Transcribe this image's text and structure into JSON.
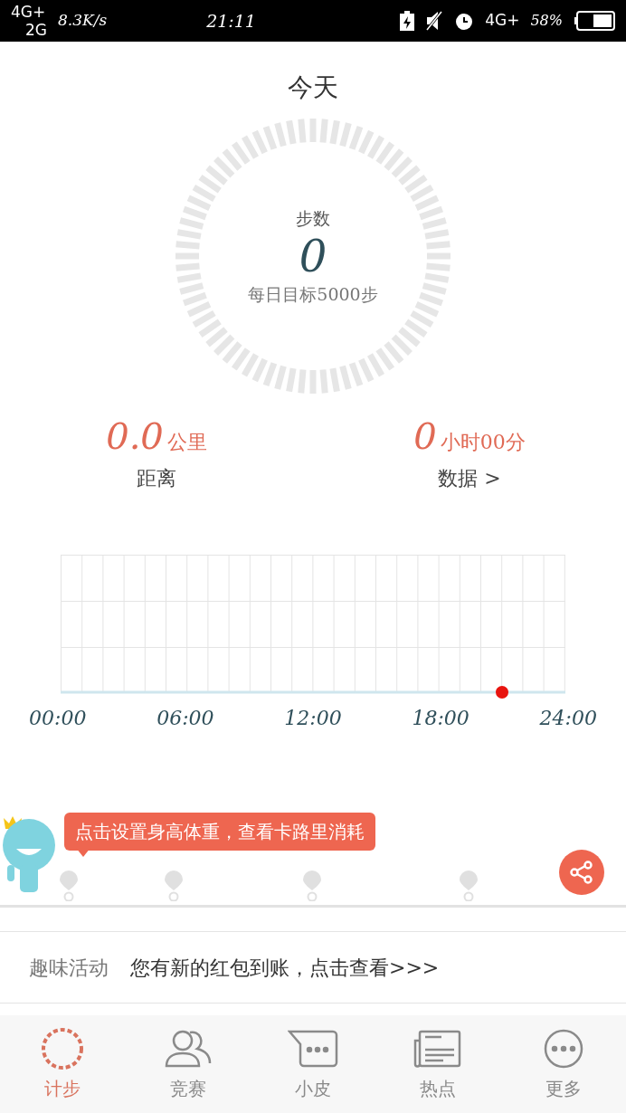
{
  "status_bar": {
    "network_top": "4G+",
    "network_bottom": "2G",
    "speed": "8.3K/s",
    "time": "21:11",
    "network_right": "4G+",
    "battery": "58%"
  },
  "title": "今天",
  "ring": {
    "label": "步数",
    "steps": "0",
    "goal": "每日目标5000步"
  },
  "stats": [
    {
      "value": "0.0",
      "unit": "公里",
      "label": "距离"
    },
    {
      "value": "0",
      "unit": "小时00分",
      "label": "数据 >"
    }
  ],
  "timeline": {
    "labels": [
      "00:00",
      "06:00",
      "12:00",
      "18:00",
      "24:00"
    ]
  },
  "tip": "点击设置身高体重，查看卡路里消耗",
  "activity": {
    "label": "趣味活动",
    "text": "您有新的红包到账，点击查看>>>"
  },
  "tabs": [
    {
      "label": "计步",
      "kind": "steps",
      "selected": true
    },
    {
      "label": "竞赛",
      "kind": "people",
      "selected": false
    },
    {
      "label": "小皮",
      "kind": "chat",
      "selected": false
    },
    {
      "label": "热点",
      "kind": "news",
      "selected": false
    },
    {
      "label": "更多",
      "kind": "more",
      "selected": false
    }
  ]
}
